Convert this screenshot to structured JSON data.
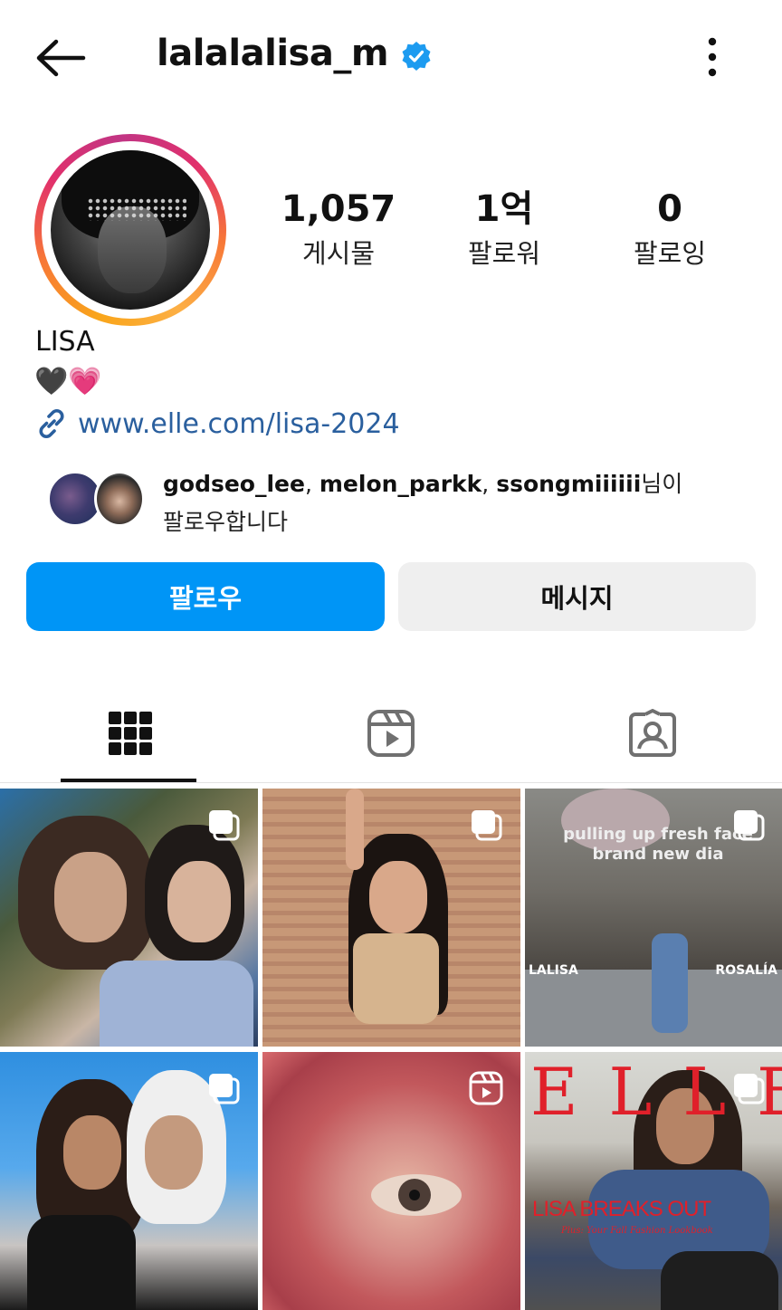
{
  "header": {
    "username": "lalalalisa_m",
    "verified": true
  },
  "profile": {
    "stats": [
      {
        "value": "1,057",
        "label": "게시물"
      },
      {
        "value": "1억",
        "label": "팔로워"
      },
      {
        "value": "0",
        "label": "팔로잉"
      }
    ],
    "display_name": "LISA",
    "bio": "🖤💗",
    "link": "www.elle.com/lisa-2024"
  },
  "followed_by": {
    "users": [
      "godseo_lee",
      "melon_parkk",
      "ssongmiiiiii"
    ],
    "sep1": ", ",
    "sep2": ", ",
    "suffix": "님이",
    "line2": "팔로우합니다"
  },
  "actions": {
    "follow_label": "팔로우",
    "message_label": "메시지"
  },
  "tabs": [
    {
      "name": "grid-icon",
      "active": true
    },
    {
      "name": "reels-icon",
      "active": false
    },
    {
      "name": "tagged-icon",
      "active": false
    }
  ],
  "posts": {
    "p3_caption": "pulling up fresh face brand new dia",
    "p3_left_label": "LALISA",
    "p3_right_label": "ROSALÍA",
    "p6_logo": "ELLE",
    "p6_headline": "LISA BREAKS OUT",
    "p6_subline": "Plus: Your Fall Fashion Lookbook"
  },
  "colors": {
    "accent": "#0095f6",
    "verified": "#1d9bf0",
    "link": "#2a5f9e"
  }
}
